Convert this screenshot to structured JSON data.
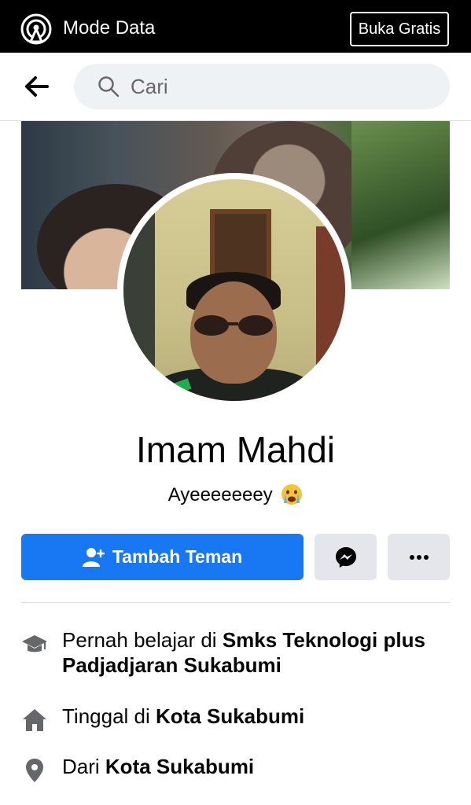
{
  "topbar": {
    "data_mode_label": "Mode Data",
    "free_button_label": "Buka Gratis"
  },
  "search": {
    "placeholder": "Cari"
  },
  "profile": {
    "name": "Imam Mahdi",
    "bio": "Ayeeeeeeey",
    "bio_emoji": "crying-face-emoji"
  },
  "actions": {
    "add_friend_label": "Tambah Teman",
    "messenger_icon": "messenger-icon",
    "more_icon": "more-dots-icon"
  },
  "info": [
    {
      "icon": "graduation-cap-icon",
      "prefix": "Pernah belajar di ",
      "bold": "Smks Teknologi plus Padjadjaran Sukabumi"
    },
    {
      "icon": "home-icon",
      "prefix": "Tinggal di ",
      "bold": "Kota Sukabumi"
    },
    {
      "icon": "location-pin-icon",
      "prefix": "Dari ",
      "bold": "Kota Sukabumi"
    }
  ],
  "colors": {
    "brand_blue": "#1877f2",
    "topbar": "#000000",
    "button_gray": "#e4e6eb"
  }
}
